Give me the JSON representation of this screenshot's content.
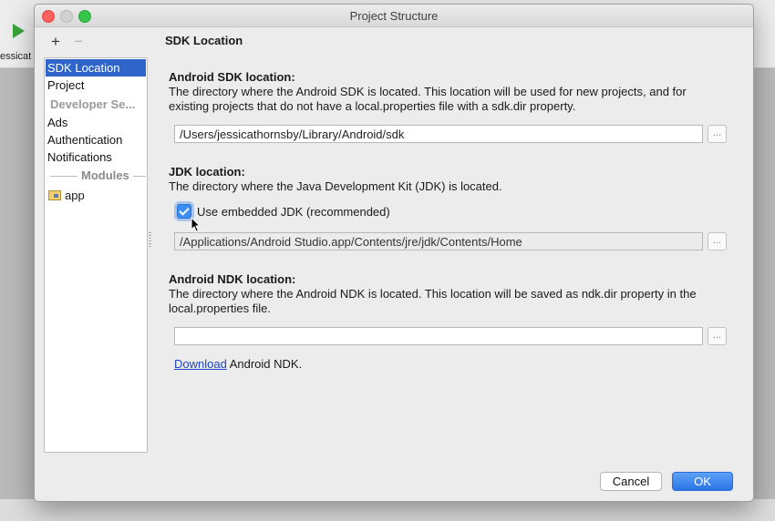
{
  "background": {
    "breadcrumb_fragment": "essicat"
  },
  "window": {
    "title": "Project Structure"
  },
  "toolbar": {
    "add_label": "+",
    "remove_label": "−"
  },
  "sidebar": {
    "items": [
      {
        "label": "SDK Location",
        "selected": true
      },
      {
        "label": "Project"
      }
    ],
    "group_label": "Developer Se...",
    "service_items": [
      {
        "label": "Ads"
      },
      {
        "label": "Authentication"
      },
      {
        "label": "Notifications"
      }
    ],
    "modules_label": "Modules",
    "modules": [
      {
        "label": "app"
      }
    ]
  },
  "content": {
    "title": "SDK Location",
    "android_sdk": {
      "heading": "Android SDK location:",
      "description": "The directory where the Android SDK is located. This location will be used for new projects, and for existing projects that do not have a local.properties file with a sdk.dir property.",
      "path": "/Users/jessicathornsby/Library/Android/sdk",
      "browse_label": "..."
    },
    "jdk": {
      "heading": "JDK location:",
      "description": "The directory where the Java Development Kit (JDK) is located.",
      "checkbox_label": "Use embedded JDK (recommended)",
      "checkbox_checked": true,
      "path": "/Applications/Android Studio.app/Contents/jre/jdk/Contents/Home",
      "browse_label": "..."
    },
    "ndk": {
      "heading": "Android NDK location:",
      "description": "The directory where the Android NDK is located. This location will be saved as ndk.dir property in the local.properties file.",
      "path": "",
      "browse_label": "...",
      "download_link": "Download",
      "download_suffix": " Android NDK."
    }
  },
  "buttons": {
    "cancel": "Cancel",
    "ok": "OK"
  },
  "colors": {
    "selection": "#2f65ca",
    "primary_button": "#2a75e6",
    "link": "#1d44c9"
  }
}
